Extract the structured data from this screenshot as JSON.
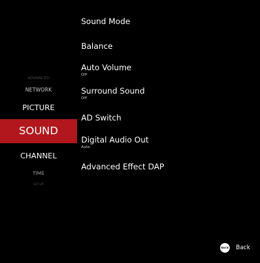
{
  "nav": {
    "advanced": "ADVANCED",
    "network": "NETWORK",
    "picture": "PICTURE",
    "sound": "SOUND",
    "channel": "CHANNEL",
    "time": "TIME",
    "setup": "SETUP"
  },
  "menu": {
    "sound_mode": "Sound Mode",
    "balance": "Balance",
    "auto_volume": {
      "label": "Auto Volume",
      "value": "Off"
    },
    "surround_sound": {
      "label": "Surround Sound",
      "value": "Off"
    },
    "ad_switch": "AD Switch",
    "digital_audio_out": {
      "label": "Digital Audio Out",
      "value": "Auto"
    },
    "advanced_effect_dap": "Advanced Effect DAP"
  },
  "footer": {
    "back_key": "BACK",
    "back_label": "Back"
  },
  "colors": {
    "background": "#000000",
    "selected": "#b1171c",
    "text": "#ffffff"
  }
}
